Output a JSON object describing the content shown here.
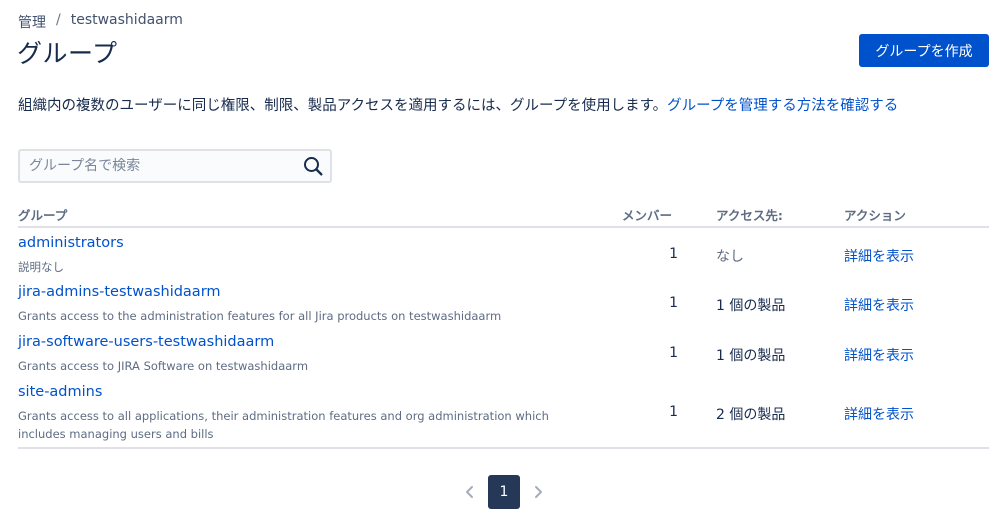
{
  "breadcrumb": {
    "root": "管理",
    "separator": "/",
    "site": "testwashidaarm"
  },
  "page": {
    "title": "グループ",
    "create_button": "グループを作成",
    "description": "組織内の複数のユーザーに同じ権限、制限、製品アクセスを適用するには、グループを使用します。",
    "description_link": "グループを管理する方法を確認する"
  },
  "search": {
    "placeholder": "グループ名で検索",
    "value": ""
  },
  "table": {
    "headers": {
      "group": "グループ",
      "members": "メンバー",
      "access": "アクセス先:",
      "action": "アクション"
    },
    "rows": [
      {
        "name": "administrators",
        "description": "説明なし",
        "members": "1",
        "access": "なし",
        "action": "詳細を表示"
      },
      {
        "name": "jira-admins-testwashidaarm",
        "description": "Grants access to the administration features for all Jira products on testwashidaarm",
        "members": "1",
        "access": "1 個の製品",
        "action": "詳細を表示"
      },
      {
        "name": "jira-software-users-testwashidaarm",
        "description": "Grants access to JIRA Software on testwashidaarm",
        "members": "1",
        "access": "1 個の製品",
        "action": "詳細を表示"
      },
      {
        "name": "site-admins",
        "description": "Grants access to all applications, their administration features and org administration which includes managing users and bills",
        "members": "1",
        "access": "2 個の製品",
        "action": "詳細を表示"
      }
    ]
  },
  "pagination": {
    "current_page": "1"
  },
  "colors": {
    "link": "#0052cc",
    "primary_button": "#0052cc",
    "current_page": "#253858",
    "text": "#172b4d",
    "muted_text": "#5e6c84"
  },
  "icons": {
    "search": "search-icon",
    "prev": "chevron-left-icon",
    "next": "chevron-right-icon"
  }
}
